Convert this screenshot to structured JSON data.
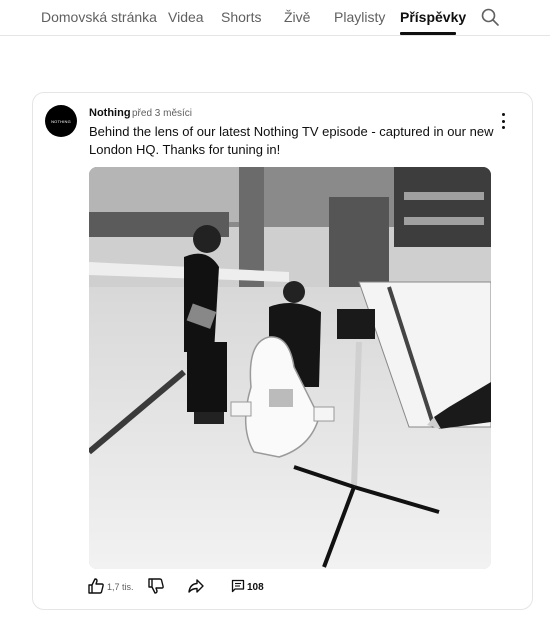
{
  "tabs": [
    {
      "label": "Domovská stránka"
    },
    {
      "label": "Videa"
    },
    {
      "label": "Shorts"
    },
    {
      "label": "Živě"
    },
    {
      "label": "Playlisty"
    },
    {
      "label": "Příspěvky",
      "active": true
    }
  ],
  "post": {
    "author": "Nothing",
    "avatar_text": "NOTHING",
    "time": "před 3 měsíci",
    "text": "Behind the lens of our latest Nothing TV episode - captured in our new London HQ. Thanks for tuning in!",
    "image_alt": "Black and white photo of two men with a camera setup in an office",
    "likes": "1,7 tis.",
    "comments": "108"
  },
  "icons": {
    "search": "search-icon",
    "more": "more-vertical-icon",
    "next": "chevron-right-icon",
    "gallery": "image-gallery-icon",
    "like": "thumbs-up-icon",
    "dislike": "thumbs-down-icon",
    "share": "share-icon",
    "comment": "comment-icon"
  },
  "colors": {
    "text": "#0f0f0f",
    "secondary": "#606060",
    "border": "#e5e5e5"
  }
}
